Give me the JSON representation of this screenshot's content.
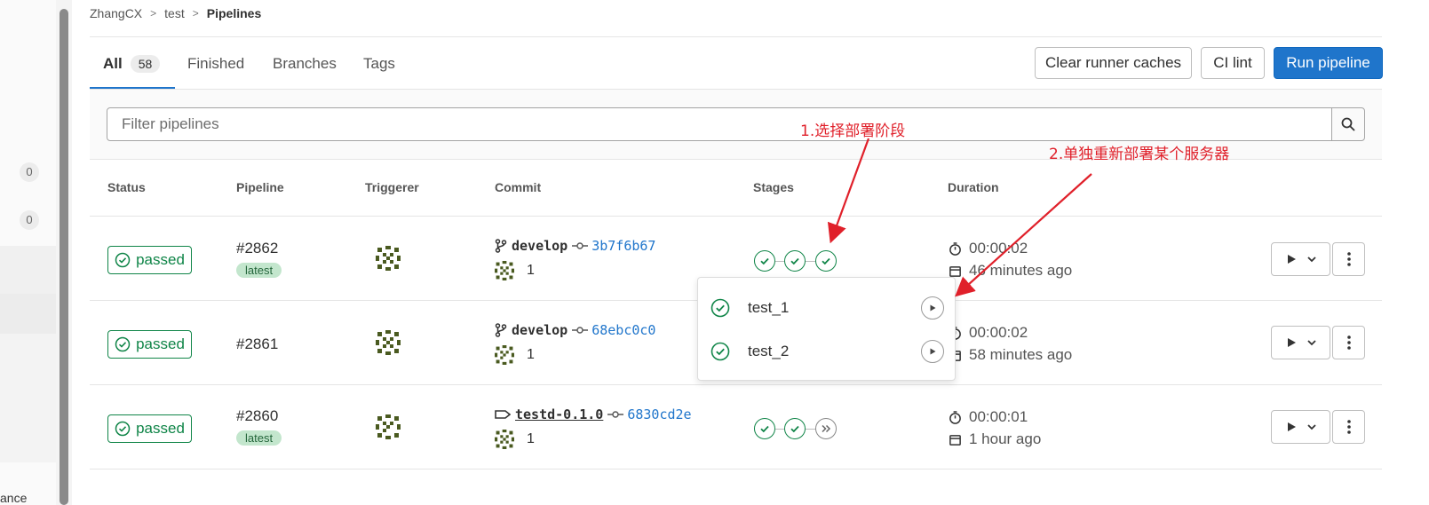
{
  "sidebar": {
    "badges": [
      "0",
      "0"
    ],
    "cut_label": "ance"
  },
  "breadcrumb": [
    "ZhangCX",
    "test",
    "Pipelines"
  ],
  "tabs": [
    {
      "label": "All",
      "count": "58"
    },
    {
      "label": "Finished"
    },
    {
      "label": "Branches"
    },
    {
      "label": "Tags"
    }
  ],
  "buttons": {
    "clear_caches": "Clear runner caches",
    "ci_lint": "CI lint",
    "run_pipeline": "Run pipeline"
  },
  "filter": {
    "placeholder": "Filter pipelines",
    "icon": "search-icon"
  },
  "columns": [
    "Status",
    "Pipeline",
    "Triggerer",
    "Commit",
    "Stages",
    "Duration"
  ],
  "pipelines": [
    {
      "status": "passed",
      "id": "#2862",
      "latest": "latest",
      "ref": "develop",
      "ref_type": "branch",
      "sha": "3b7f6b67",
      "commit_msg": "1",
      "stages": [
        "success",
        "success",
        "success"
      ],
      "duration": "00:00:02",
      "finished": "46 minutes ago"
    },
    {
      "status": "passed",
      "id": "#2861",
      "latest": "",
      "ref": "develop",
      "ref_type": "branch",
      "sha": "68ebc0c0",
      "commit_msg": "1",
      "stages": [],
      "duration": "00:00:02",
      "finished": "58 minutes ago"
    },
    {
      "status": "passed",
      "id": "#2860",
      "latest": "latest",
      "ref": "testd-0.1.0",
      "ref_type": "tag",
      "sha": "6830cd2e",
      "commit_msg": "1",
      "stages": [
        "success",
        "success",
        "skipped"
      ],
      "duration": "00:00:01",
      "finished": "1 hour ago"
    }
  ],
  "stage_dropdown": {
    "jobs": [
      {
        "name": "test_1",
        "status": "success"
      },
      {
        "name": "test_2",
        "status": "success"
      }
    ]
  },
  "annotations": {
    "first": "1.选择部署阶段",
    "second": "2.单独重新部署某个服务器"
  },
  "colors": {
    "primary": "#1f75cb",
    "success": "#108548",
    "annotation": "#e0202a"
  }
}
